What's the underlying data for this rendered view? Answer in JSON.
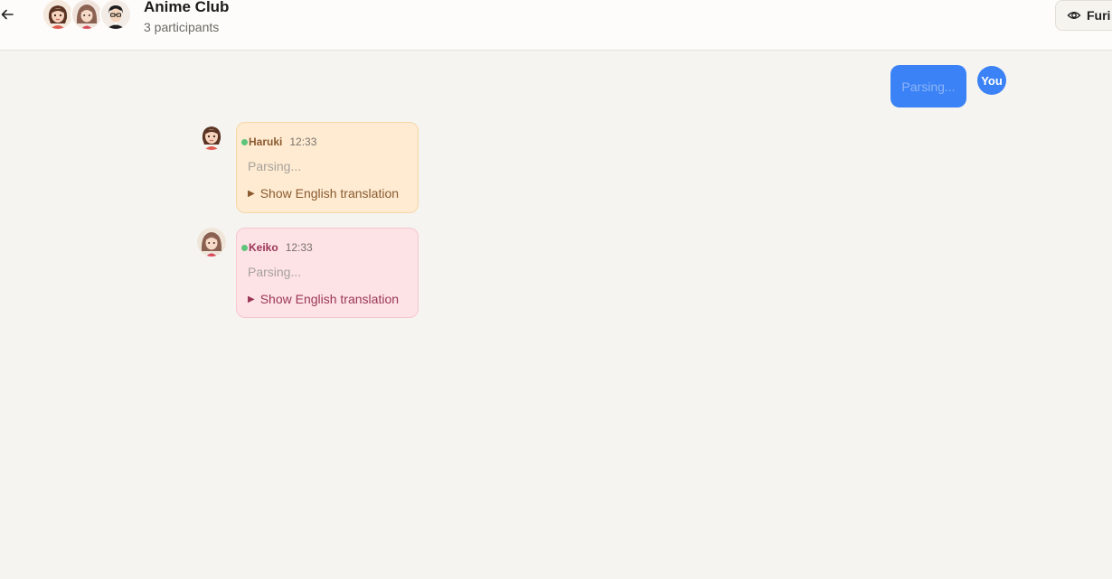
{
  "header": {
    "back_icon": "arrow-left-icon",
    "title": "Anime Club",
    "subtitle": "3 participants",
    "furigana_label": "Furi",
    "furigana_icon": "eye-icon"
  },
  "own_message": {
    "text": "Parsing...",
    "avatar_label": "You",
    "color": "#3b82f6"
  },
  "messages": [
    {
      "sender": "Haruki",
      "time": "12:33",
      "text": "Parsing...",
      "toggle_label": "Show English translation",
      "toggle_icon": "triangle-right-icon",
      "color": "#feebd2"
    },
    {
      "sender": "Keiko",
      "time": "12:33",
      "text": "Parsing...",
      "toggle_label": "Show English translation",
      "toggle_icon": "triangle-right-icon",
      "color": "#fde2e6"
    }
  ]
}
